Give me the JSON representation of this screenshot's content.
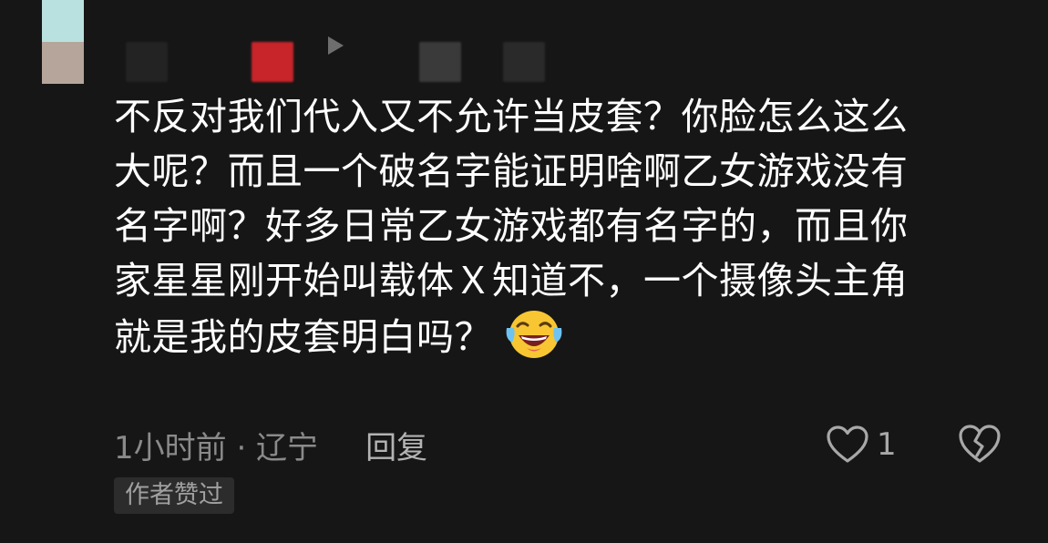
{
  "comment": {
    "lines": [
      "不反对我们代入又不允许当皮套？你脸怎么这么",
      "大呢？而且一个破名字能证明啥啊乙女游戏没有",
      "名字啊？好多日常乙女游戏都有名字的，而且你",
      "家星星刚开始叫载体Ｘ知道不，一个摄像头主角",
      "就是我的皮套明白吗？"
    ],
    "emoji": "laughing-crying-emoji"
  },
  "meta": {
    "time_location": "1小时前 · 辽宁",
    "reply_label": "回复"
  },
  "actions": {
    "like_icon": "heart-outline-icon",
    "like_count": "1",
    "dislike_icon": "broken-heart-icon"
  },
  "badge": {
    "author_liked": "作者赞过"
  },
  "colors": {
    "background": "#161616",
    "text": "#ffffff",
    "meta": "#8a8a8a",
    "reply": "#b3b3b3",
    "badge_bg": "#2c2c2c"
  }
}
